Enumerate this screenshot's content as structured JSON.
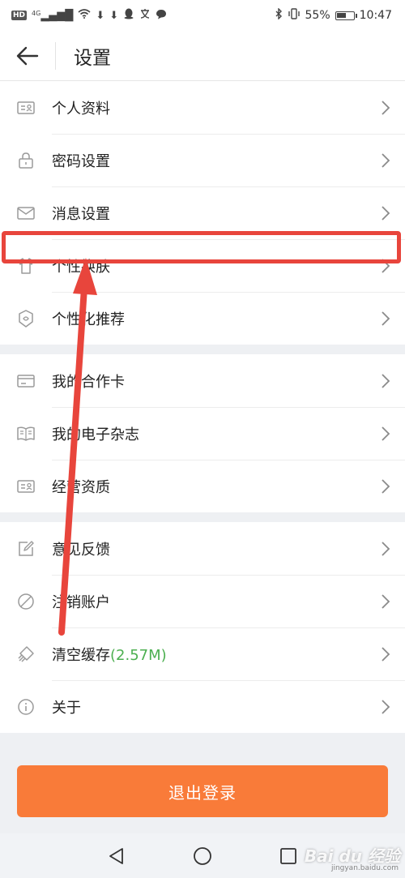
{
  "status_bar": {
    "network_badge": "HD",
    "signal_label": "4G",
    "battery_percent": "55%",
    "battery_level": 0.55,
    "time": "10:47",
    "icons": [
      "wifi-icon",
      "download-icon",
      "download-icon",
      "qq-icon",
      "translate-icon",
      "chat-icon",
      "bluetooth-icon",
      "vibrate-icon"
    ]
  },
  "header": {
    "title": "设置",
    "back_icon": "arrow-left-icon"
  },
  "groups": [
    {
      "items": [
        {
          "label": "个人资料",
          "icon": "id-card-icon"
        },
        {
          "label": "密码设置",
          "icon": "lock-icon"
        },
        {
          "label": "消息设置",
          "icon": "envelope-icon"
        },
        {
          "label": "个性换肤",
          "icon": "tshirt-icon"
        },
        {
          "label": "个性化推荐",
          "icon": "badge-icon"
        }
      ]
    },
    {
      "items": [
        {
          "label": "我的合作卡",
          "icon": "card-icon"
        },
        {
          "label": "我的电子杂志",
          "icon": "book-icon"
        },
        {
          "label": "经营资质",
          "icon": "id-card-icon"
        }
      ]
    },
    {
      "items": [
        {
          "label": "意见反馈",
          "icon": "edit-icon"
        },
        {
          "label": "注销账户",
          "icon": "forbid-icon"
        },
        {
          "label": "清空缓存",
          "extra": "(2.57M)",
          "icon": "eraser-icon"
        },
        {
          "label": "关于",
          "icon": "info-icon"
        }
      ]
    }
  ],
  "logout_label": "退出登录",
  "nav": {
    "back": "nav-back-icon",
    "home": "nav-home-icon",
    "recent": "nav-recent-icon"
  },
  "watermark": {
    "brand": "Bai du 经验",
    "url": "jingyan.baidu.com"
  },
  "colors": {
    "accent": "#f97b39",
    "highlight": "#e8453c",
    "cache_size": "#4caf50",
    "icon": "#9a9a9a"
  }
}
